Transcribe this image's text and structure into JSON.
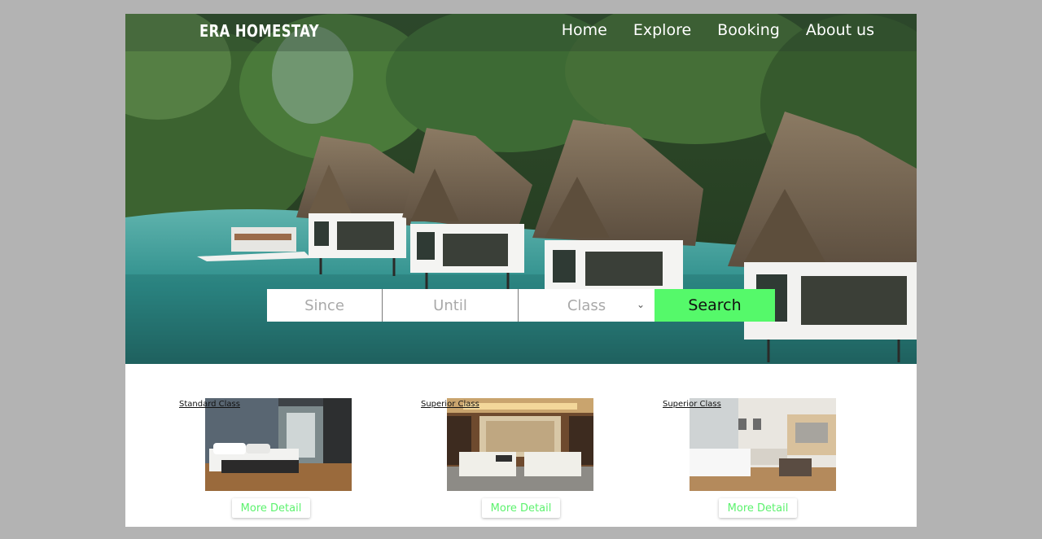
{
  "header": {
    "logo": "ERA HOMESTAY",
    "nav": [
      "Home",
      "Explore",
      "Booking",
      "About us"
    ]
  },
  "search": {
    "since_placeholder": "Since",
    "until_placeholder": "Until",
    "class_placeholder": "Class",
    "button_label": "Search"
  },
  "rooms": [
    {
      "class_label": "Standard Class",
      "button_label": "More Detail"
    },
    {
      "class_label": "Superior Class",
      "button_label": "More Detail"
    },
    {
      "class_label": "Superior Class",
      "button_label": "More Detail"
    }
  ],
  "colors": {
    "accent_green": "#55f96a",
    "page_bg": "#b3b3b3"
  }
}
